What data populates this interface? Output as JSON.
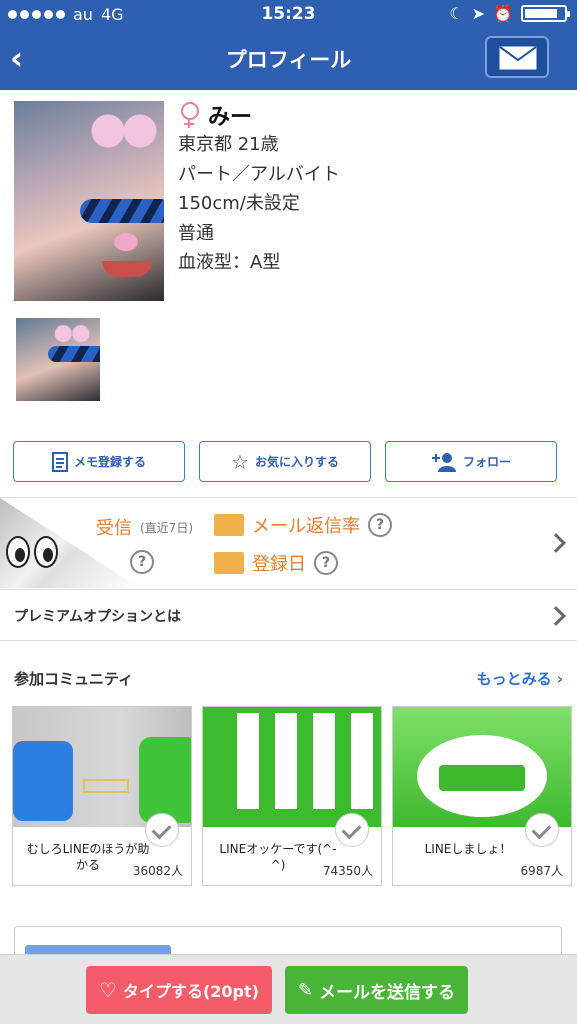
{
  "status_bar": {
    "carrier": "au",
    "network": "4G",
    "time": "15:23",
    "battery_level": 0.85
  },
  "nav": {
    "back_icon": "chevron-left-icon",
    "title": "プロフィール",
    "mail_icon": "envelope-icon"
  },
  "profile": {
    "gender_icon": "female-icon",
    "name": "みー",
    "location_age": "東京都  21歳",
    "occupation": "パート／アルバイト",
    "height_body": "150cm/未設定",
    "figure": "普通",
    "blood_type": "血液型：A型"
  },
  "actions": {
    "memo": "メモ登録する",
    "favorite": "お気に入りする",
    "follow": "フォロー"
  },
  "stats": {
    "received_label_partial": "受信",
    "received_period": "(直近7日)",
    "reply_rate": "メール返信率",
    "register_date": "登録日",
    "help": "?"
  },
  "premium": {
    "label": "プレミアムオプションとは"
  },
  "communities": {
    "heading": "参加コミュニティ",
    "more": "もっとみる",
    "items": [
      {
        "title": "むしろLINEのほうが助かる",
        "members": "36082人"
      },
      {
        "title": "LINEオッケーです(^-^)",
        "members": "74350人"
      },
      {
        "title": "LINEしましょ！",
        "members": "6987人"
      }
    ]
  },
  "bottom": {
    "like_button": "タイプする(20pt)",
    "mail_button": "メールを送信する"
  },
  "colors": {
    "nav_blue": "#2f5fb0",
    "orange": "#e67e2f",
    "like_red": "#f45c6a",
    "mail_green": "#4bb53a",
    "link_blue": "#2f6fd0"
  }
}
